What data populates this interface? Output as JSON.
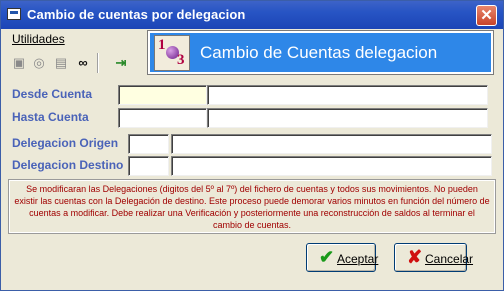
{
  "window": {
    "title": "Cambio de cuentas por delegacion",
    "close_label": "✕"
  },
  "menu": {
    "items": [
      {
        "label": "Utilidades"
      }
    ]
  },
  "toolbar": {
    "buttons": [
      {
        "icon": "save-icon",
        "glyph": "▣",
        "enabled": false
      },
      {
        "icon": "preview-icon",
        "glyph": "◎",
        "enabled": false
      },
      {
        "icon": "print-icon",
        "glyph": "▤",
        "enabled": false
      },
      {
        "icon": "binoculars-icon",
        "glyph": "∞",
        "enabled": true
      },
      {
        "icon": "exit-door-icon",
        "glyph": "⇥",
        "enabled": true
      }
    ]
  },
  "banner": {
    "logo_top": "1",
    "logo_bottom": "3",
    "title": "Cambio de Cuentas delegacion",
    "background": "#2e87e8"
  },
  "form": {
    "desde_cuenta": {
      "label": "Desde Cuenta",
      "code": "",
      "desc": ""
    },
    "hasta_cuenta": {
      "label": "Hasta Cuenta",
      "code": "",
      "desc": ""
    },
    "delegacion_origen": {
      "label": "Delegacion Origen",
      "code": "",
      "desc": ""
    },
    "delegacion_destino": {
      "label": "Delegacion Destino",
      "code": "",
      "desc": ""
    }
  },
  "notice": "Se modificaran las Delegaciones (digitos del 5º al 7º) del fichero de cuentas y todos sus movimientos. No pueden existir las cuentas con la Delegación de destino. Este proceso puede demorar varios minutos en función del número de cuentas a modificar. Debe realizar una Verificación y posteriormente una reconstrucción de saldos al terminar el cambio de cuentas.",
  "buttons": {
    "accept": "Aceptar",
    "cancel": "Cancelar"
  },
  "colors": {
    "label": "#4a63b8",
    "notice_text": "#a00000",
    "active_field": "#ffffe1"
  }
}
